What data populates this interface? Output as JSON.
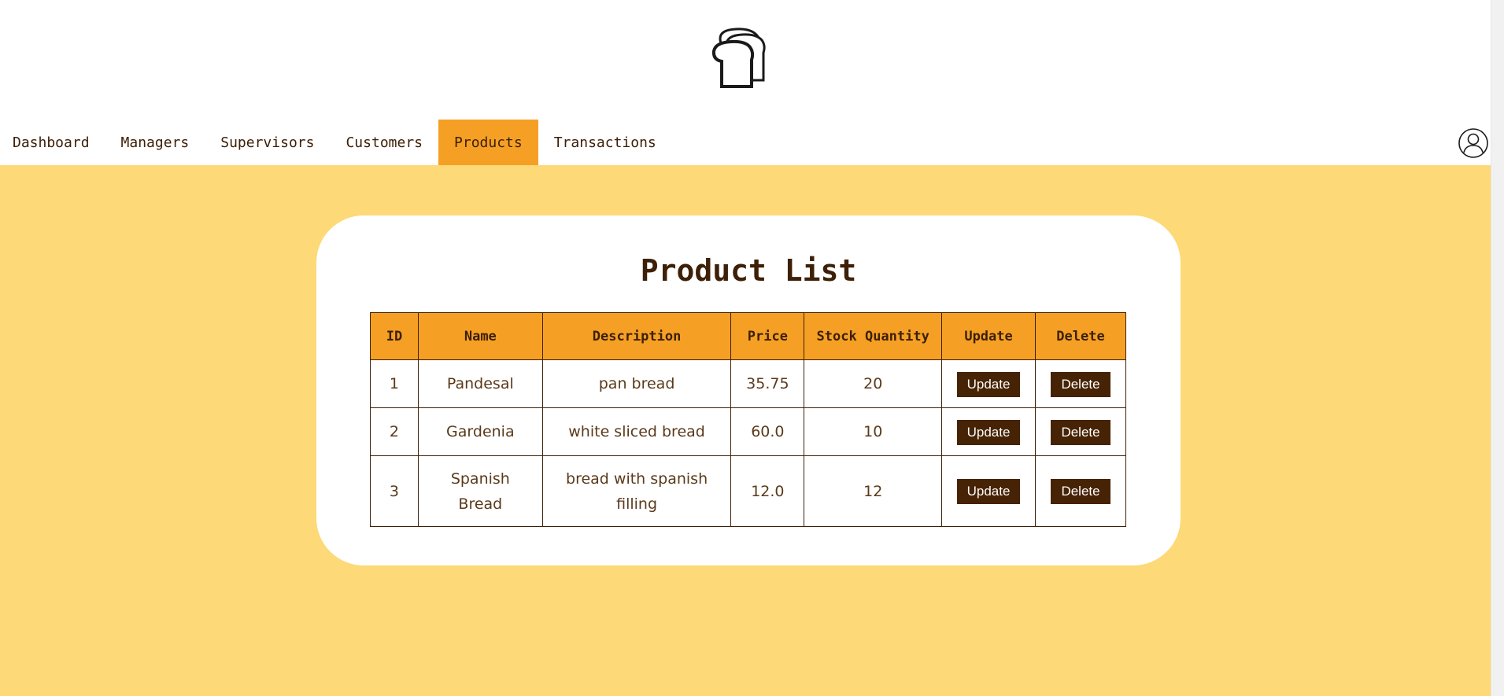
{
  "header": {
    "logo_icon": "bread-slices-icon"
  },
  "nav": {
    "items": [
      {
        "label": "Dashboard"
      },
      {
        "label": "Managers"
      },
      {
        "label": "Supervisors"
      },
      {
        "label": "Customers"
      },
      {
        "label": "Products"
      },
      {
        "label": "Transactions"
      }
    ],
    "active": "Products",
    "profile_icon": "user-profile-icon"
  },
  "main": {
    "title": "Product List",
    "columns": [
      "ID",
      "Name",
      "Description",
      "Price",
      "Stock Quantity",
      "Update",
      "Delete"
    ],
    "rows": [
      {
        "id": "1",
        "name": "Pandesal",
        "description": "pan bread",
        "price": "35.75",
        "stock": "20",
        "update": "Update",
        "delete": "Delete"
      },
      {
        "id": "2",
        "name": "Gardenia",
        "description": "white sliced bread",
        "price": "60.0",
        "stock": "10",
        "update": "Update",
        "delete": "Delete"
      },
      {
        "id": "3",
        "name": "Spanish Bread",
        "description": "bread with spanish filling",
        "price": "12.0",
        "stock": "12",
        "update": "Update",
        "delete": "Delete"
      }
    ]
  },
  "colors": {
    "accent": "#f5a025",
    "background": "#fdd977",
    "text": "#3d2007",
    "button": "#472305"
  }
}
